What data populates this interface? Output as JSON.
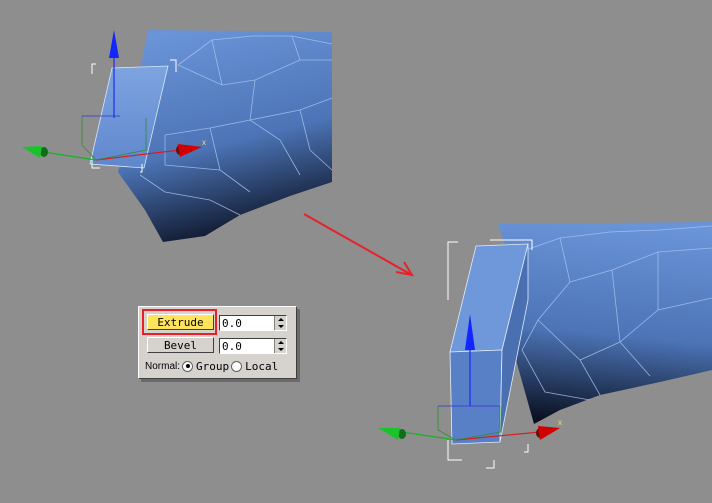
{
  "panel": {
    "extrude_label": "Extrude",
    "extrude_value": "0.0",
    "bevel_label": "Bevel",
    "bevel_value": "0.0",
    "normal_label": "Normal:",
    "group_label": "Group",
    "local_label": "Local",
    "selected_normal": "Group"
  },
  "gizmo": {
    "x_axis_label": "x"
  },
  "colors": {
    "viewport_bg": "#8e8e8e",
    "mesh": "#5a84c8",
    "extrude_active": "#fee35d",
    "highlight": "#e8202a",
    "arrow": "#e8202a"
  }
}
